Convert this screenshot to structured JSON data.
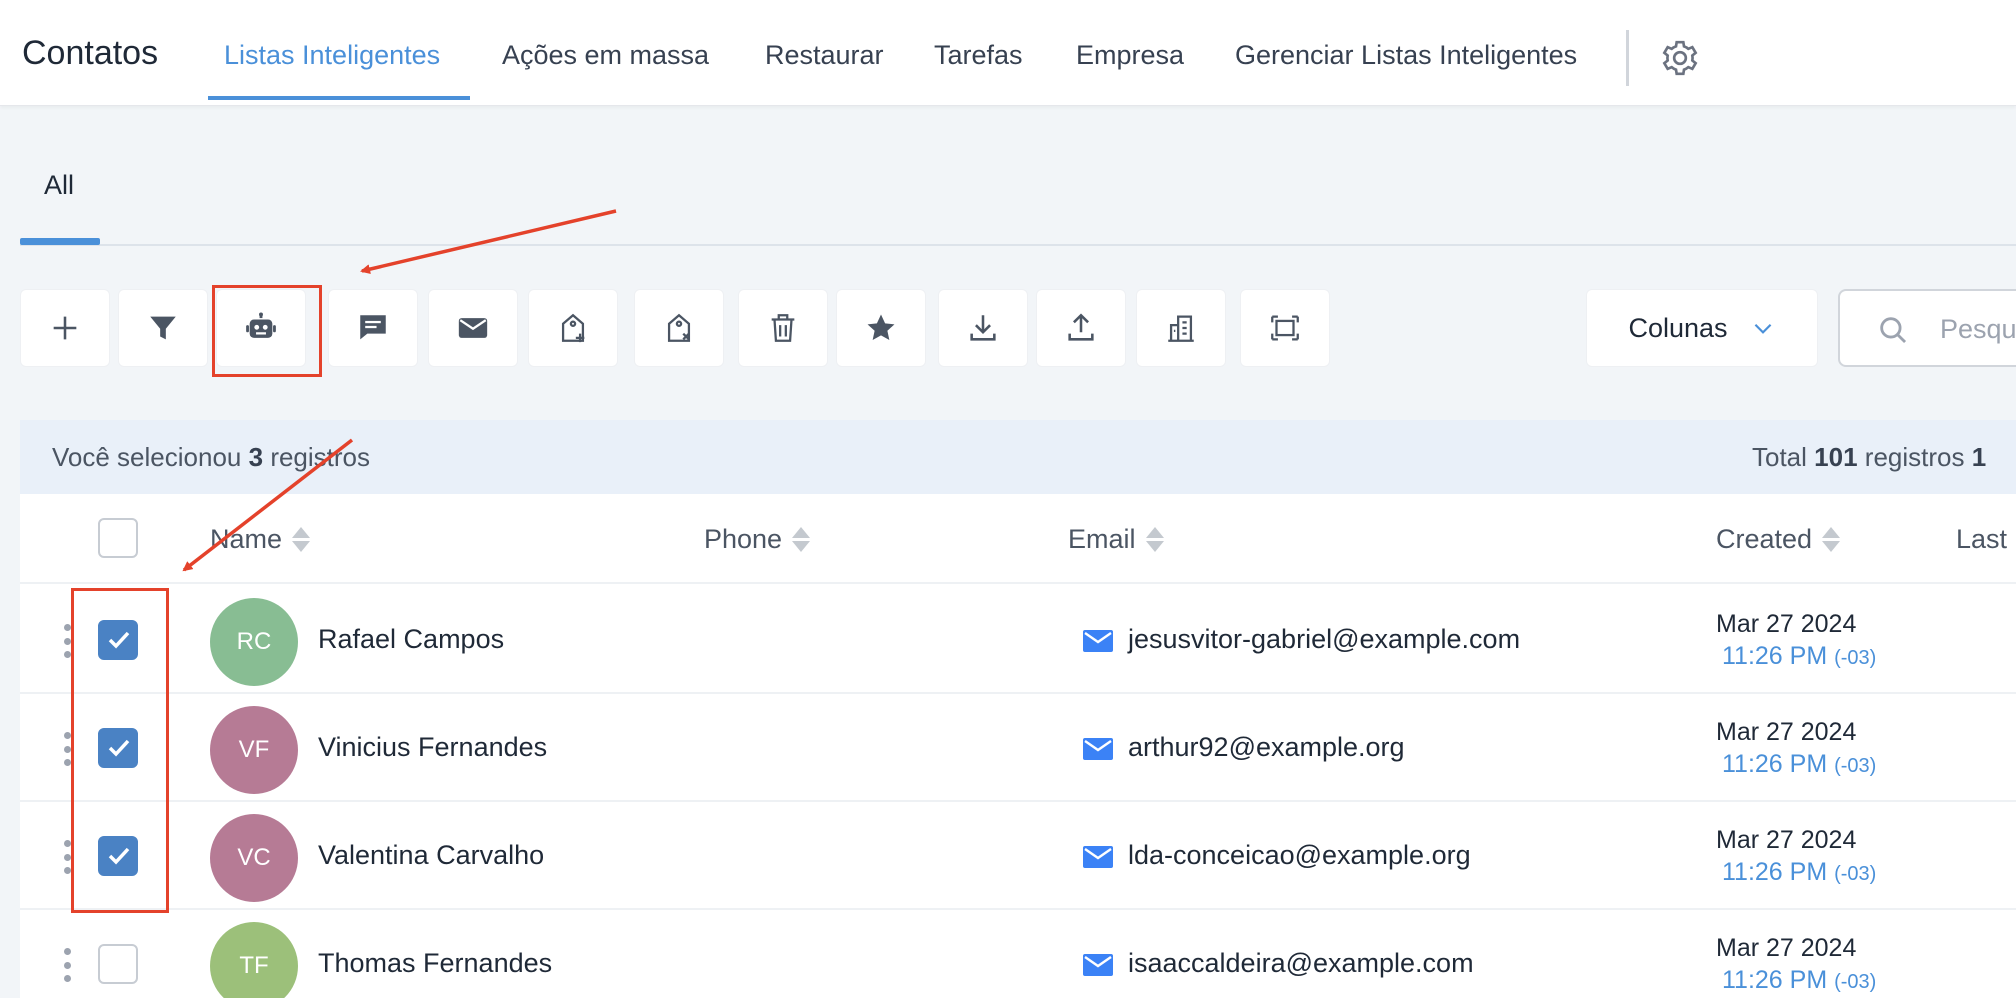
{
  "header": {
    "app_title": "Contatos",
    "tabs": [
      {
        "label": "Listas Inteligentes"
      },
      {
        "label": "Ações em massa"
      },
      {
        "label": "Restaurar"
      },
      {
        "label": "Tarefas"
      },
      {
        "label": "Empresa"
      },
      {
        "label": "Gerenciar Listas Inteligentes"
      }
    ]
  },
  "subtabs": {
    "active": "All"
  },
  "toolbar": {
    "buttons": [
      "plus-icon",
      "filter-icon",
      "robot-icon",
      "chat-icon",
      "email-icon",
      "tag-add-icon",
      "tag-remove-icon",
      "trash-icon",
      "star-icon",
      "download-icon",
      "upload-icon",
      "building-icon",
      "merge-icon"
    ],
    "columns_label": "Colunas",
    "search_placeholder": "Pesquisar"
  },
  "banner": {
    "selected_prefix": "Você selecionou",
    "selected_count": "3",
    "selected_suffix": "registros",
    "total_prefix": "Total",
    "total_count": "101",
    "total_suffix": "registros",
    "page_fragment": "1"
  },
  "table": {
    "columns": [
      "Name",
      "Phone",
      "Email",
      "Created",
      "Last"
    ],
    "rows": [
      {
        "initials": "RC",
        "name": "Rafael Campos",
        "email": "jesusvitor-gabriel@example.com",
        "date": "Mar 27 2024",
        "time": "11:26 PM",
        "tz": "(-03)",
        "checked": true,
        "avatar_color": "#88bd93"
      },
      {
        "initials": "VF",
        "name": "Vinicius Fernandes",
        "email": "arthur92@example.org",
        "date": "Mar 27 2024",
        "time": "11:26 PM",
        "tz": "(-03)",
        "checked": true,
        "avatar_color": "#b67b95"
      },
      {
        "initials": "VC",
        "name": "Valentina Carvalho",
        "email": "lda-conceicao@example.org",
        "date": "Mar 27 2024",
        "time": "11:26 PM",
        "tz": "(-03)",
        "checked": true,
        "avatar_color": "#b67b95"
      },
      {
        "initials": "TF",
        "name": "Thomas Fernandes",
        "email": "isaaccaldeira@example.com",
        "date": "Mar 27 2024",
        "time": "11:26 PM",
        "tz": "(-03)",
        "checked": false,
        "avatar_color": "#9cc07a"
      }
    ]
  },
  "colors": {
    "accent": "#4a90d9",
    "checkbox_checked": "#4a82c4",
    "annotation_red": "#e4422b",
    "banner_bg": "#e9f0f9"
  }
}
